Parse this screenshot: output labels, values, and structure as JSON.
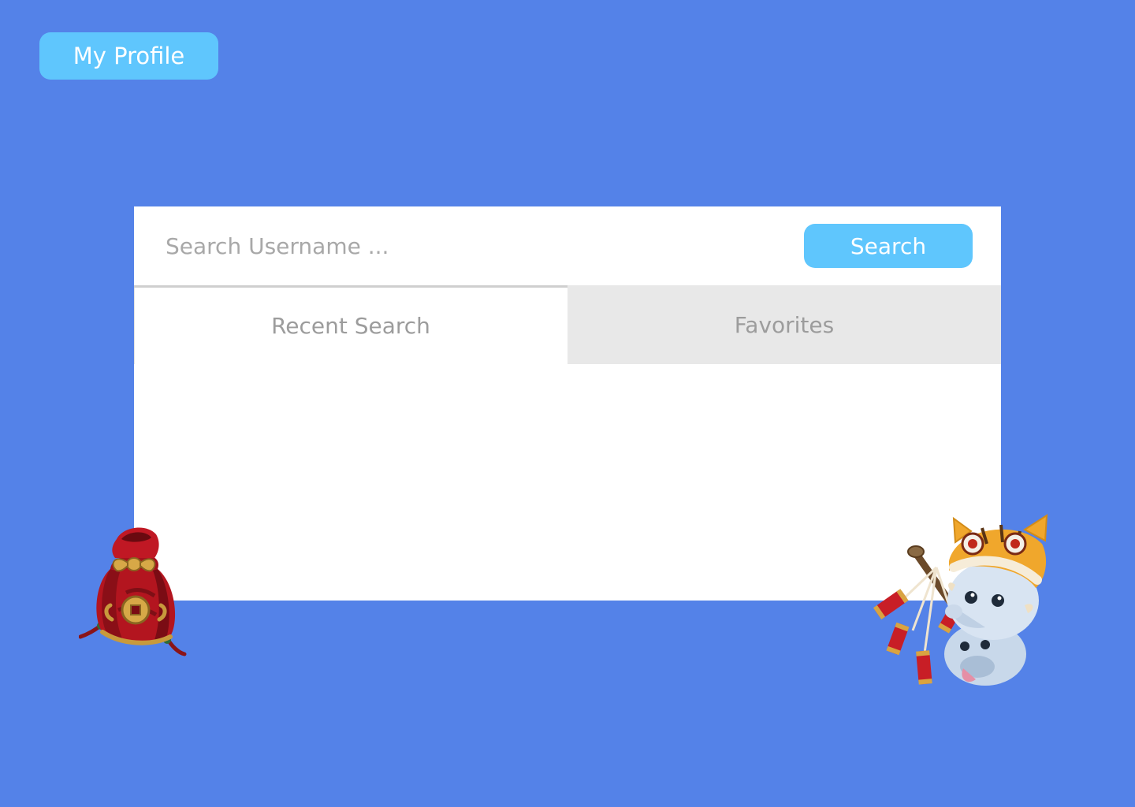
{
  "header": {
    "profile_label": "My Profile"
  },
  "search": {
    "placeholder": "Search Username ...",
    "value": "",
    "button_label": "Search"
  },
  "tabs": [
    {
      "label": "Recent Search",
      "active": true
    },
    {
      "label": "Favorites",
      "active": false
    }
  ],
  "decorations": {
    "left_icon": "lucky-bag-icon",
    "right_icon": "poro-tiger-firecracker-icon"
  },
  "colors": {
    "background": "#5482E8",
    "accent": "#5FC6FD",
    "panel": "#FFFFFF",
    "inactive_tab": "#E8E8E8",
    "muted_text": "#9C9C9C"
  }
}
